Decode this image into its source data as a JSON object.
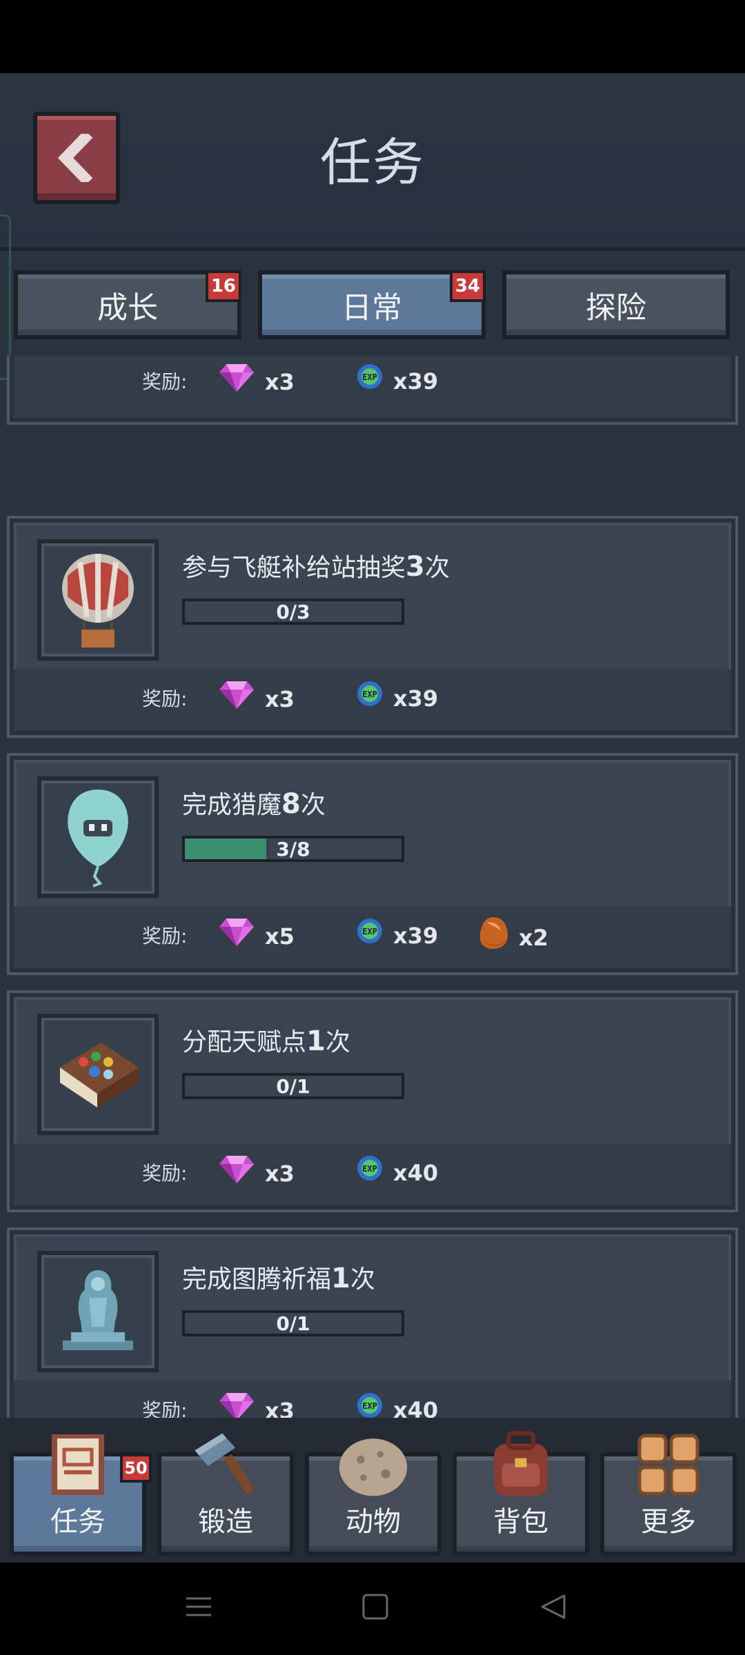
{
  "header": {
    "title": "任务"
  },
  "tabs": [
    {
      "label": "成长",
      "badge": "16"
    },
    {
      "label": "日常",
      "badge": "34",
      "active": true
    },
    {
      "label": "探险"
    }
  ],
  "reward_label": "奖励:",
  "partial_card": {
    "rewards": [
      {
        "icon": "gem-icon",
        "amount": "x3"
      },
      {
        "icon": "exp-orb-icon",
        "amount": "x39"
      }
    ]
  },
  "tasks": [
    {
      "icon": "airship-balloon-icon",
      "title_prefix": "参与飞艇补给站抽奖",
      "title_num": "3",
      "title_suffix": "次",
      "progress_text": "0/3",
      "progress": 0,
      "rewards": [
        {
          "icon": "gem-icon",
          "amount": "x3"
        },
        {
          "icon": "exp-orb-icon",
          "amount": "x39"
        }
      ]
    },
    {
      "icon": "ghost-balloon-icon",
      "title_prefix": "完成猎魔",
      "title_num": "8",
      "title_suffix": "次",
      "progress_text": "3/8",
      "progress": 0.375,
      "rewards": [
        {
          "icon": "gem-icon",
          "amount": "x5"
        },
        {
          "icon": "exp-orb-icon",
          "amount": "x39"
        },
        {
          "icon": "copper-ore-icon",
          "amount": "x2"
        }
      ]
    },
    {
      "icon": "talent-book-icon",
      "title_prefix": "分配天赋点",
      "title_num": "1",
      "title_suffix": "次",
      "progress_text": "0/1",
      "progress": 0,
      "rewards": [
        {
          "icon": "gem-icon",
          "amount": "x3"
        },
        {
          "icon": "exp-orb-icon",
          "amount": "x40"
        }
      ]
    },
    {
      "icon": "totem-statue-icon",
      "title_prefix": "完成图腾祈福",
      "title_num": "1",
      "title_suffix": "次",
      "progress_text": "0/1",
      "progress": 0,
      "rewards": [
        {
          "icon": "gem-icon",
          "amount": "x3"
        },
        {
          "icon": "exp-orb-icon",
          "amount": "x40"
        }
      ]
    }
  ],
  "nav": [
    {
      "label": "任务",
      "icon": "task-scroll-icon",
      "badge": "50",
      "active": true
    },
    {
      "label": "锻造",
      "icon": "hammer-icon"
    },
    {
      "label": "动物",
      "icon": "rock-egg-icon"
    },
    {
      "label": "背包",
      "icon": "backpack-icon"
    },
    {
      "label": "更多",
      "icon": "grid-more-icon"
    }
  ],
  "colors": {
    "accent": "#5d7898",
    "badge": "#c83a3a",
    "progress_fill": "#3c8f6e",
    "background": "#2b3340"
  }
}
